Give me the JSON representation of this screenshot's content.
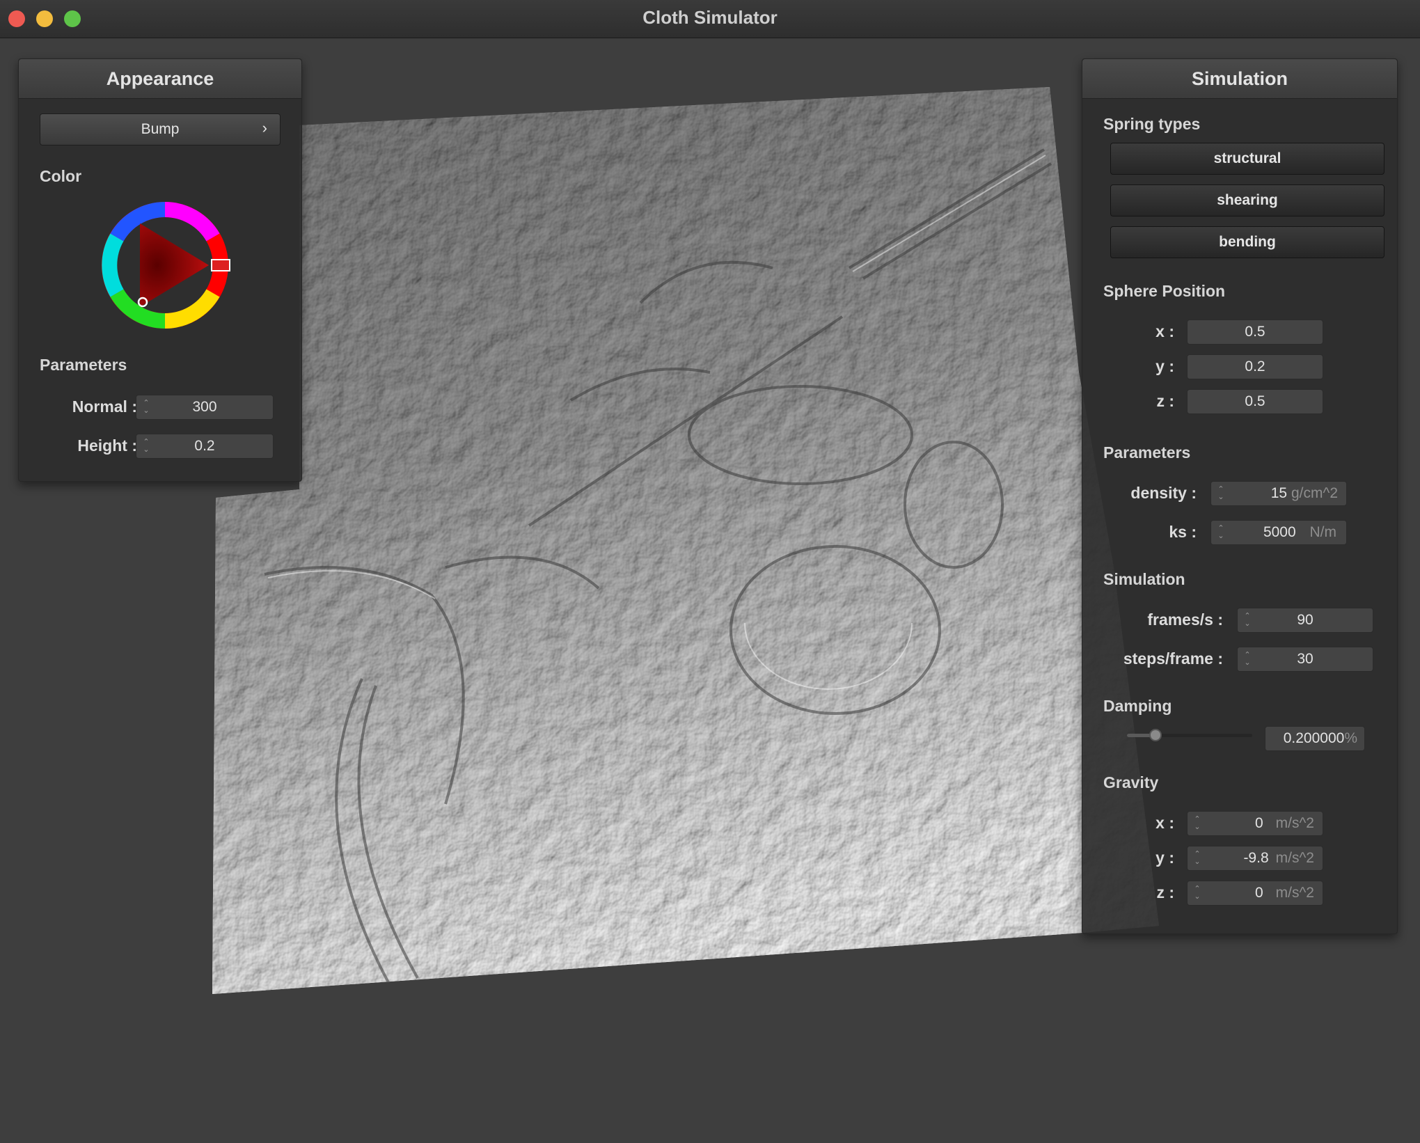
{
  "window": {
    "title": "Cloth Simulator"
  },
  "appearance": {
    "title": "Appearance",
    "shader_value": "Bump",
    "shader_arrow": "›",
    "color_section": "Color",
    "parameters_section": "Parameters",
    "normal_label": "Normal :",
    "normal_value": "300",
    "height_label": "Height :",
    "height_value": "0.2"
  },
  "simulation": {
    "title": "Simulation",
    "spring_types_section": "Spring types",
    "spring_buttons": [
      "structural",
      "shearing",
      "bending"
    ],
    "sphere_section": "Sphere Position",
    "sphere": {
      "x_label": "x :",
      "x": "0.5",
      "y_label": "y :",
      "y": "0.2",
      "z_label": "z :",
      "z": "0.5"
    },
    "parameters_section": "Parameters",
    "density_label": "density :",
    "density_value": "15",
    "density_unit": "g/cm^2",
    "ks_label": "ks :",
    "ks_value": "5000",
    "ks_unit": "N/m",
    "sim_section": "Simulation",
    "fps_label": "frames/s :",
    "fps_value": "90",
    "steps_label": "steps/frame :",
    "steps_value": "30",
    "damping_section": "Damping",
    "damping_value": "0.200000",
    "damping_unit": "%",
    "damping_fraction": 0.2,
    "gravity_section": "Gravity",
    "gravity": {
      "x_label": "x :",
      "x": "0",
      "y_label": "y :",
      "y": "-9.8",
      "z_label": "z :",
      "z": "0",
      "unit": "m/s^2"
    }
  },
  "colors": {
    "background": "#3e3e3e",
    "panel": "#2d2d2d",
    "accent_red": "#cc2020"
  }
}
